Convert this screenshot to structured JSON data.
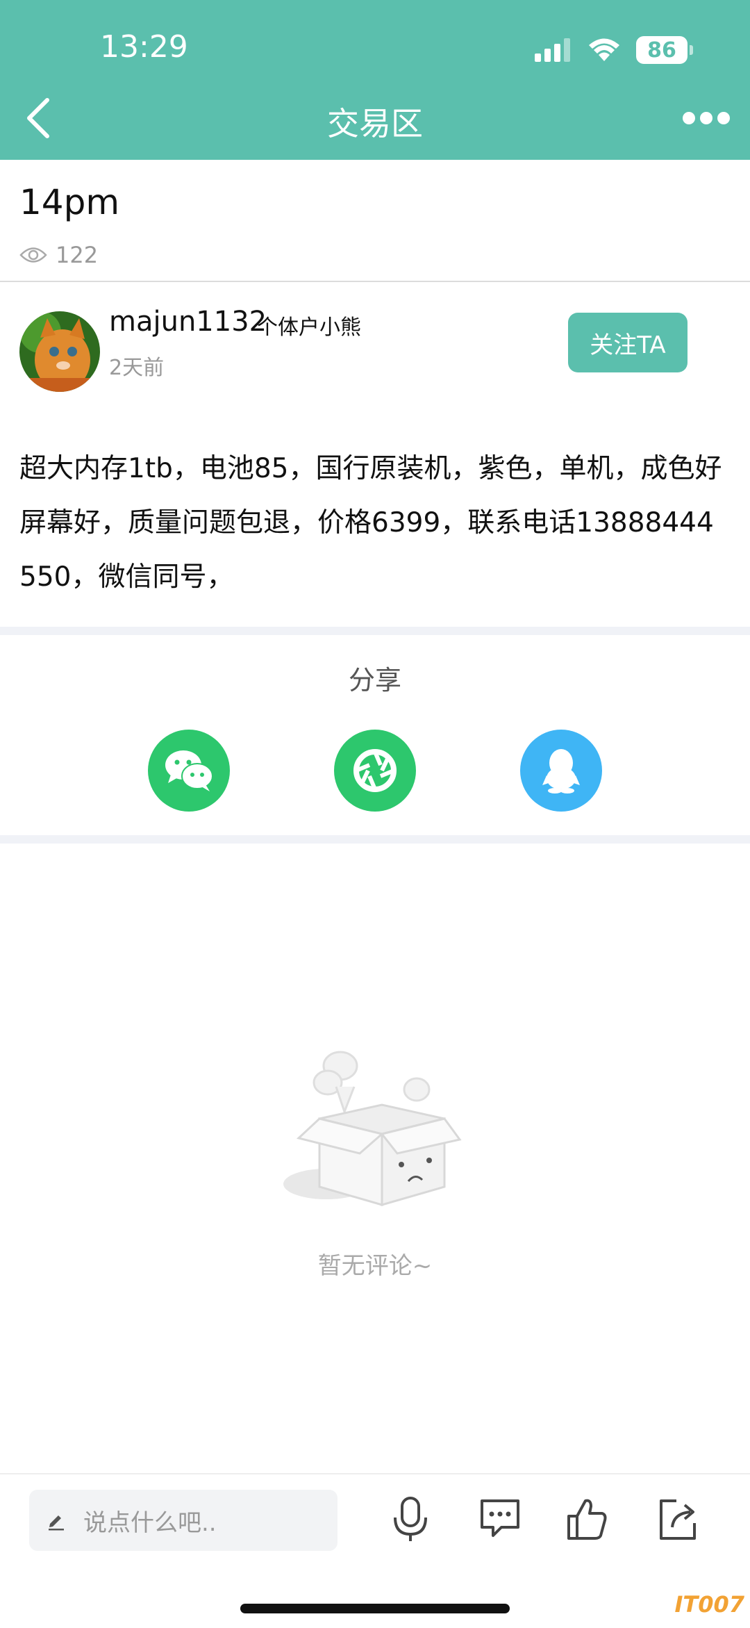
{
  "status_bar": {
    "time": "13:29",
    "battery": "86"
  },
  "nav": {
    "title": "交易区"
  },
  "post": {
    "title": "14pm",
    "views": "122",
    "content": "超大内存1tb，电池85，国行原装机，紫色，单机，成色好屏幕好，质量问题包退，价格6399，联系电话13888444550，微信同号，"
  },
  "author": {
    "name": "majun1132",
    "tag": "个体户小熊",
    "time": "2天前",
    "follow_label": "关注TA"
  },
  "share": {
    "title": "分享",
    "items": [
      "wechat",
      "moments",
      "qq"
    ]
  },
  "comments": {
    "empty_text": "暂无评论~"
  },
  "bottom_bar": {
    "placeholder": "说点什么吧.."
  },
  "watermark": "IT007",
  "colors": {
    "accent": "#5bbfad",
    "wechat": "#2dc76d",
    "qq": "#3fb5f5"
  }
}
